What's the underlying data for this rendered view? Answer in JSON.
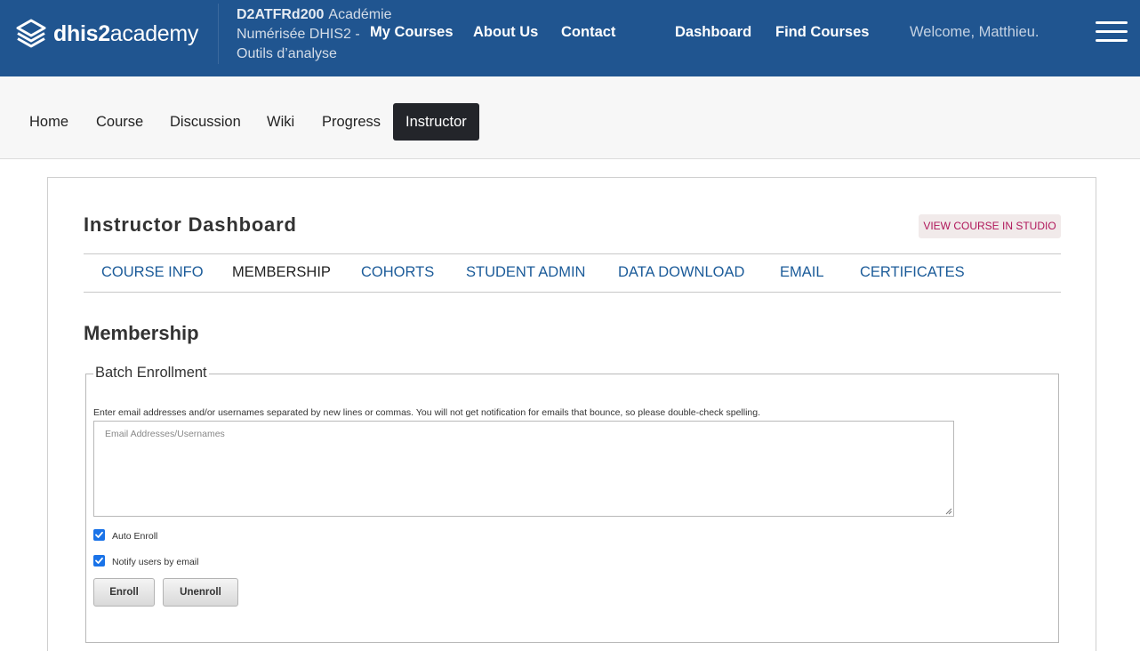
{
  "header": {
    "logo": {
      "brand_bold": "dhis2",
      "brand_light": "academy",
      "icon": "dhis2-layers-icon"
    },
    "course": {
      "code": "D2ATFRd200",
      "name": "Académie Numérisée DHIS2 - Outils d’analyse"
    },
    "nav": [
      {
        "label": "My Courses"
      },
      {
        "label": "About Us"
      },
      {
        "label": "Contact"
      },
      {
        "label": "Dashboard"
      },
      {
        "label": "Find Courses"
      }
    ],
    "welcome": "Welcome, Matthieu.",
    "menu_icon": "hamburger-menu-icon",
    "colors": {
      "background": "#205590"
    }
  },
  "course_nav": {
    "tabs": [
      {
        "label": "Home"
      },
      {
        "label": "Course"
      },
      {
        "label": "Discussion"
      },
      {
        "label": "Wiki"
      },
      {
        "label": "Progress"
      },
      {
        "label": "Instructor"
      }
    ],
    "active": "Instructor"
  },
  "dashboard": {
    "title": "Instructor Dashboard",
    "studio_button": "VIEW COURSE IN STUDIO",
    "tabs": [
      {
        "label": "COURSE INFO"
      },
      {
        "label": "MEMBERSHIP"
      },
      {
        "label": "COHORTS"
      },
      {
        "label": "STUDENT ADMIN"
      },
      {
        "label": "DATA DOWNLOAD"
      },
      {
        "label": "EMAIL"
      },
      {
        "label": "CERTIFICATES"
      }
    ],
    "active_tab": "MEMBERSHIP",
    "colors": {
      "link": "#1b5b99",
      "studio_text": "#b0175a"
    }
  },
  "membership": {
    "title": "Membership",
    "batch": {
      "legend": "Batch Enrollment",
      "instructions": "Enter email addresses and/or usernames separated by new lines or commas. You will not get notification for emails that bounce, so please double-check spelling.",
      "textarea_placeholder": "Email Addresses/Usernames",
      "textarea_value": "",
      "auto_enroll": {
        "label": "Auto Enroll",
        "checked": true
      },
      "notify": {
        "label": "Notify users by email",
        "checked": true
      },
      "enroll_button": "Enroll",
      "unenroll_button": "Unenroll"
    }
  }
}
